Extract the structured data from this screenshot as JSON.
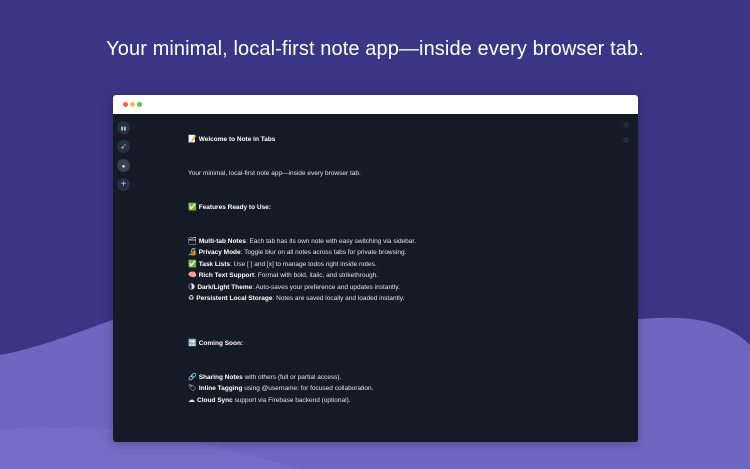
{
  "headline": "Your minimal, local-first note app—inside every browser tab.",
  "colors": {
    "background": "#3a3585",
    "wave": "#6e69c2",
    "window_bg": "#141b27",
    "titlebar": "#ffffff"
  },
  "sidebar": {
    "items": [
      {
        "icon": "panel-icon",
        "glyph": "▮▮"
      },
      {
        "icon": "rocket-icon",
        "glyph": "➶"
      },
      {
        "icon": "lightbulb-icon",
        "glyph": "●"
      },
      {
        "icon": "plus-icon",
        "glyph": "+"
      }
    ]
  },
  "note": {
    "title_emoji": "📝",
    "title": "Welcome to Note in Tabs",
    "tagline": "Your minimal, local-first note app—inside every browser tab.",
    "features_heading_emoji": "✅",
    "features_heading": "Features Ready to Use:",
    "features": [
      {
        "emoji": "🗂",
        "name": "Multi-tab Notes",
        "desc": ": Each tab has its own note with easy switching via sidebar."
      },
      {
        "emoji": "🔏",
        "name": "Privacy Mode",
        "desc": ": Toggle blur on all notes across tabs for private browsing."
      },
      {
        "emoji": "✅",
        "name": "Task Lists",
        "desc": ": Use [ ] and [x] to manage todos right inside notes."
      },
      {
        "emoji": "🧠",
        "name": "Rich Text Support",
        "desc": ": Format with bold, italic, and strikethrough."
      },
      {
        "emoji": "🌗",
        "name": "Dark/Light Theme",
        "desc": ": Auto-saves your preference and updates instantly."
      },
      {
        "emoji": "♻",
        "name": "Persistent Local Storage",
        "desc": ": Notes are saved locally and loaded instantly."
      }
    ],
    "soon_heading_emoji": "🔜",
    "soon_heading": "Coming Soon:",
    "soon": [
      {
        "emoji": "🔗",
        "name": "Sharing Notes",
        "desc": " with others (full or partial access)."
      },
      {
        "emoji": "🏷",
        "name": "Inline Tagging",
        "desc": " using @username: for focused collaboration."
      },
      {
        "emoji": "☁",
        "name": "Cloud Sync",
        "desc": " support via Firebase backend (optional)."
      }
    ]
  }
}
